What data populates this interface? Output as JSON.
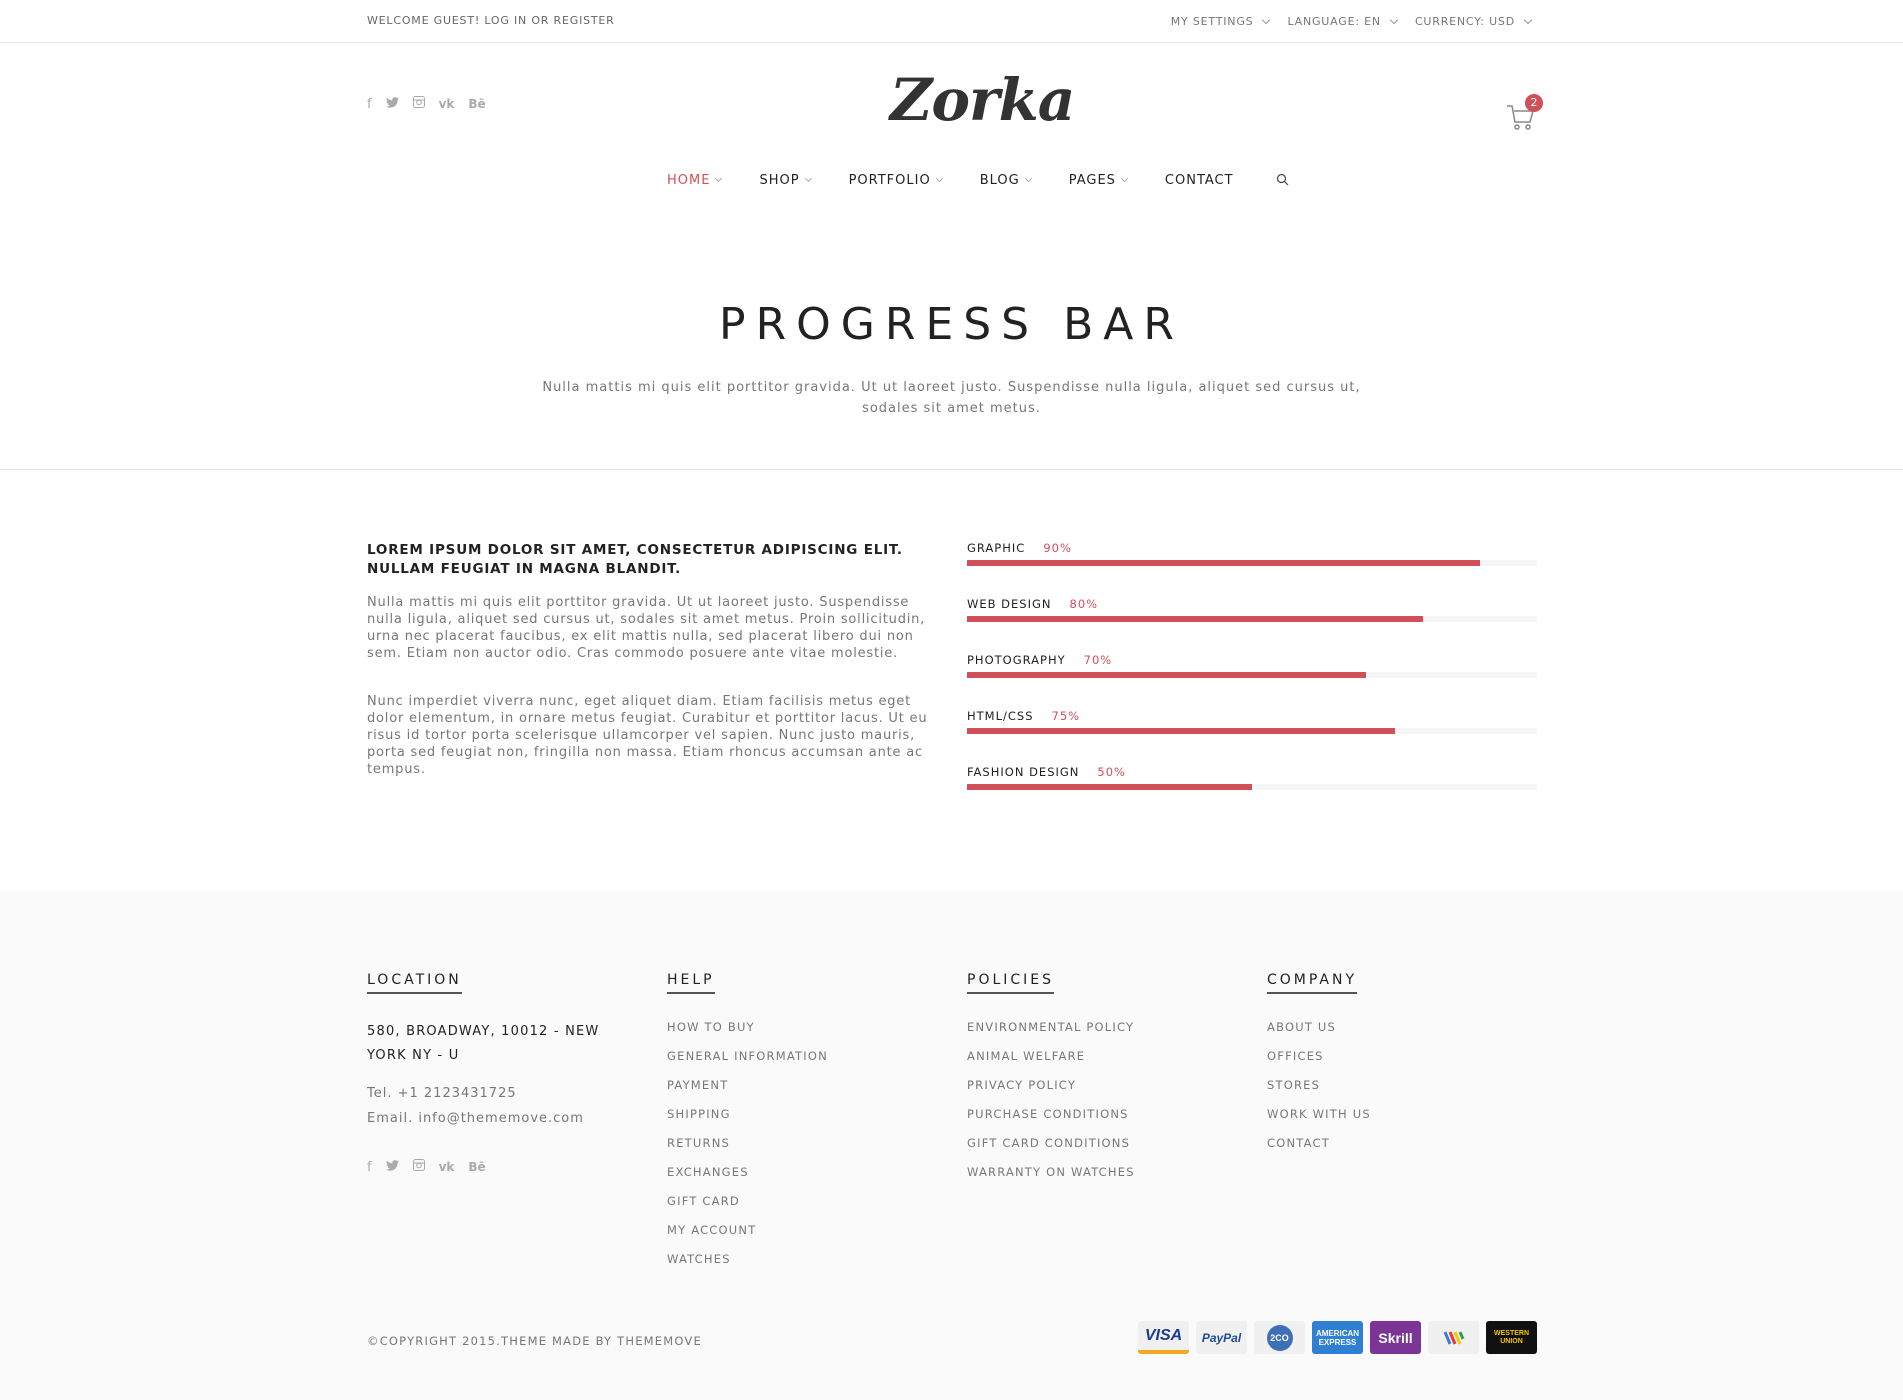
{
  "topbar": {
    "welcome": "WELCOME GUEST! LOG IN OR REGISTER",
    "settings": [
      {
        "label": "MY SETTINGS"
      },
      {
        "label": "LANGUAGE: EN"
      },
      {
        "label": "CURRENCY: USD"
      }
    ]
  },
  "header": {
    "logo": "Zorka",
    "social_icons": [
      "facebook-icon",
      "twitter-icon",
      "instagram-icon",
      "vk-icon",
      "behance-icon"
    ],
    "cart_count": "2",
    "nav": [
      {
        "label": "HOME",
        "active": true
      },
      {
        "label": "SHOP"
      },
      {
        "label": "PORTFOLIO"
      },
      {
        "label": "BLOG"
      },
      {
        "label": "PAGES"
      },
      {
        "label": "CONTACT"
      }
    ]
  },
  "hero": {
    "title": "PROGRESS BAR",
    "subtitle": "Nulla mattis mi quis elit porttitor gravida. Ut ut laoreet justo. Suspendisse nulla ligula, aliquet sed cursus ut, sodales sit amet metus."
  },
  "content": {
    "lead": "LOREM IPSUM DOLOR SIT AMET, CONSECTETUR ADIPISCING ELIT. NULLAM FEUGIAT IN MAGNA BLANDIT.",
    "para1": "Nulla mattis mi quis elit porttitor gravida. Ut ut laoreet justo. Suspendisse nulla ligula, aliquet sed cursus ut, sodales sit amet metus. Proin sollicitudin, urna nec placerat faucibus, ex elit mattis nulla, sed placerat libero dui non sem. Etiam non auctor odio. Cras commodo posuere ante vitae molestie.",
    "para2": "Nunc imperdiet viverra nunc, eget aliquet diam. Etiam facilisis metus eget dolor elementum, in ornare metus feugiat. Curabitur et porttitor lacus. Ut eu risus id tortor porta scelerisque ullamcorper vel sapien. Nunc justo mauris, porta sed feugiat non, fringilla non massa. Etiam rhoncus accumsan ante ac tempus.",
    "skills": [
      {
        "label": "GRAPHIC",
        "pct_text": "90%",
        "value": 90
      },
      {
        "label": "WEB DESIGN",
        "pct_text": "80%",
        "value": 80
      },
      {
        "label": "PHOTOGRAPHY",
        "pct_text": "70%",
        "value": 70
      },
      {
        "label": "HTML/CSS",
        "pct_text": "75%",
        "value": 75
      },
      {
        "label": "FASHION DESIGN",
        "pct_text": "50%",
        "value": 50
      }
    ],
    "accent": "#d0505a"
  },
  "footer": {
    "location": {
      "heading": "LOCATION",
      "address": "580, BROADWAY, 10012 - NEW YORK NY - U",
      "tel": "Tel. +1 2123431725",
      "email": "Email. info@thememove.com"
    },
    "help": {
      "heading": "HELP",
      "links": [
        "HOW TO BUY",
        "GENERAL INFORMATION",
        "PAYMENT",
        "SHIPPING",
        "RETURNS",
        "EXCHANGES",
        "GIFT CARD",
        "MY ACCOUNT",
        "WATCHES"
      ]
    },
    "policies": {
      "heading": "POLICIES",
      "links": [
        "ENVIRONMENTAL POLICY",
        "ANIMAL WELFARE",
        "PRIVACY POLICY",
        "PURCHASE CONDITIONS",
        "GIFT CARD CONDITIONS",
        "WARRANTY ON WATCHES"
      ]
    },
    "company": {
      "heading": "COMPANY",
      "links": [
        "ABOUT US",
        "OFFICES",
        "STORES",
        "WORK WITH US",
        "CONTACT"
      ]
    },
    "copyright": "©COPYRIGHT 2015.THEME MADE BY THEMEMOVE",
    "payments": [
      {
        "name": "visa-icon",
        "text": "VISA"
      },
      {
        "name": "paypal-icon",
        "text": "PayPal"
      },
      {
        "name": "2co-icon",
        "text": "2CO"
      },
      {
        "name": "amex-icon",
        "text": "AMERICAN EXPRESS"
      },
      {
        "name": "skrill-icon",
        "text": "Skrill"
      },
      {
        "name": "google-wallet-icon",
        "text": ""
      },
      {
        "name": "western-union-icon",
        "text": "WESTERN UNION"
      }
    ]
  }
}
